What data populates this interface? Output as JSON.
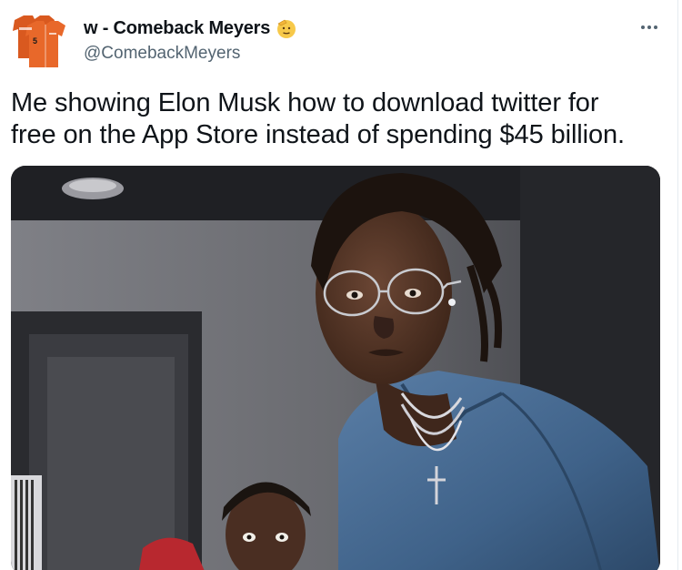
{
  "tweet": {
    "author": {
      "display_name": "w - Comeback Meyers",
      "handle": "@ComebackMeyers",
      "avatar_icon": "orange-baseball-jersey-avatar",
      "badge_icon": "saluting-face-emoji"
    },
    "more_icon": "more-options-icon",
    "text_line1": "Me showing Elon Musk how to download twitter for",
    "text_line2": "free on the App Store instead of spending $45 billion.",
    "media": {
      "type": "photo",
      "description_icon": "studio-photo"
    }
  },
  "colors": {
    "text_primary": "#0f1419",
    "text_secondary": "#536471",
    "jersey_orange": "#e8682a"
  }
}
